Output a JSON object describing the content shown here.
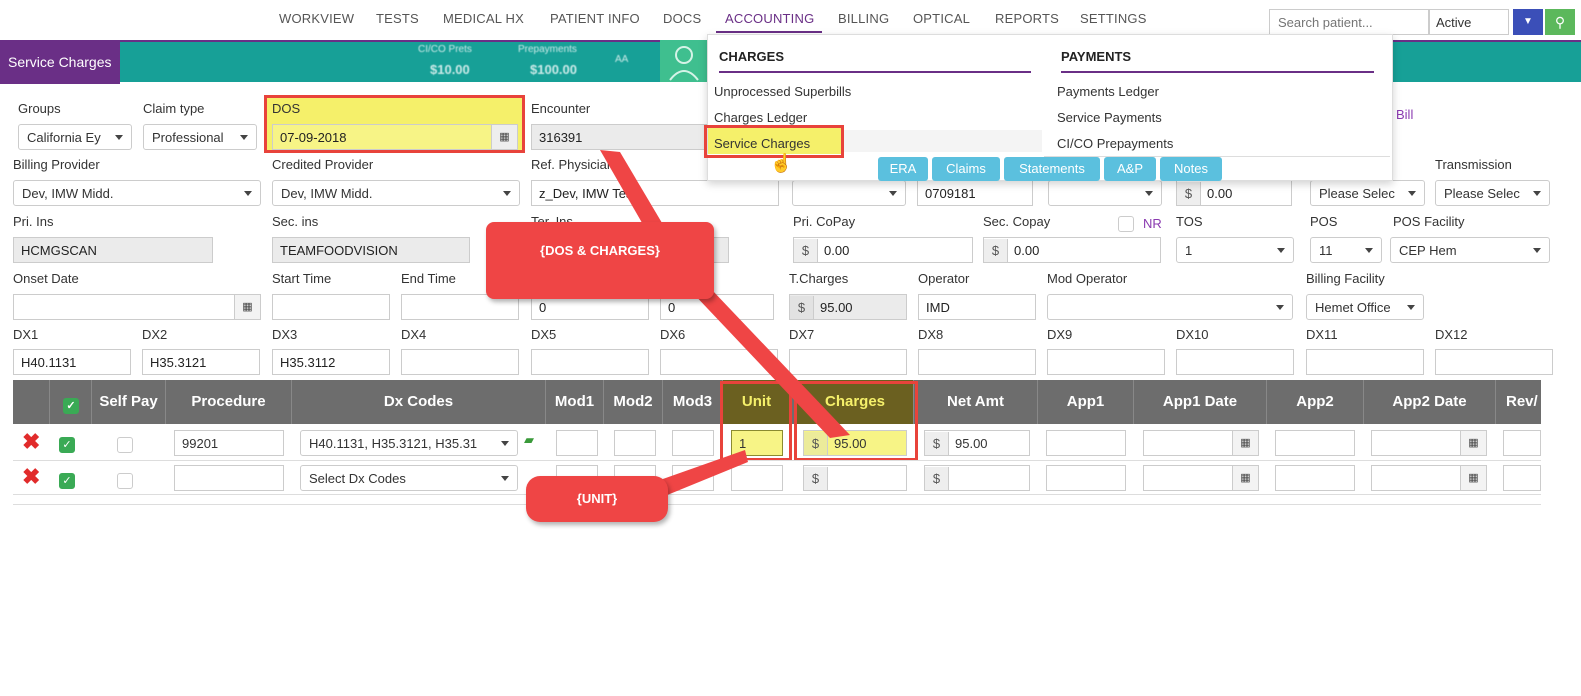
{
  "nav": {
    "items": [
      "WORKVIEW",
      "TESTS",
      "MEDICAL HX",
      "PATIENT INFO",
      "DOCS",
      "ACCOUNTING",
      "BILLING",
      "OPTICAL",
      "REPORTS",
      "SETTINGS"
    ],
    "active": "ACCOUNTING",
    "search_placeholder": "Search patient...",
    "status": "Active"
  },
  "page_tab": "Service Charges",
  "band": {
    "blur1": "CI/CO Prets",
    "blur2": "$10.00",
    "blur3": "Prepayments",
    "blur4": "$100.00",
    "blur5": "AA"
  },
  "form": {
    "groups_label": "Groups",
    "groups_value": "California Ey",
    "claim_label": "Claim type",
    "claim_value": "Professional",
    "dos_label": "DOS",
    "dos_value": "07-09-2018",
    "encounter_label": "Encounter",
    "encounter_value": "316391",
    "bill_link": "Bill",
    "billing_provider_label": "Billing Provider",
    "billing_provider_value": "Dev, IMW Midd.",
    "credited_label": "Credited Provider",
    "credited_value": "Dev, IMW Midd.",
    "ref_label": "Ref. Physician",
    "ref_value": "z_Dev, IMW Test",
    "hidden_value": "0709181",
    "amount_value": "0.00",
    "transmission_label": "Transmission",
    "please_select": "Please Selec",
    "pri_ins_label": "Pri. Ins",
    "pri_ins_value": "HCMGSCAN",
    "sec_ins_label": "Sec. ins",
    "sec_ins_value": "TEAMFOODVISION",
    "ter_label": "Ter. Ins",
    "pri_copay_label": "Pri. CoPay",
    "pri_copay_value": "0.00",
    "sec_copay_label": "Sec. Copay",
    "sec_copay_value": "0.00",
    "nr": "NR",
    "tos_label": "TOS",
    "tos_value": "1",
    "pos_label": "POS",
    "pos_value": "11",
    "pos_facility_label": "POS Facility",
    "pos_facility_value": "CEP Hem",
    "onset_label": "Onset Date",
    "start_label": "Start Time",
    "end_label": "End Time",
    "zero1": "0",
    "zero2": "0",
    "tcharges_label": "T.Charges",
    "tcharges_value": "95.00",
    "operator_label": "Operator",
    "operator_value": "IMD",
    "mod_operator_label": "Mod Operator",
    "billing_facility_label": "Billing Facility",
    "billing_facility_value": "Hemet Office",
    "dx_labels": [
      "DX1",
      "DX2",
      "DX3",
      "DX4",
      "DX5",
      "DX6",
      "DX7",
      "DX8",
      "DX9",
      "DX10",
      "DX11",
      "DX12"
    ],
    "dx_values": [
      "H40.1131",
      "H35.3121",
      "H35.3112",
      "",
      "",
      "",
      "",
      "",
      "",
      "",
      "",
      ""
    ]
  },
  "grid": {
    "headers": [
      "Self Pay",
      "Procedure",
      "Dx Codes",
      "Mod1",
      "Mod2",
      "Mod3",
      "Unit",
      "Charges",
      "Net Amt",
      "App1",
      "App1 Date",
      "App2",
      "App2 Date",
      "Rev/"
    ],
    "rows": [
      {
        "procedure": "99201",
        "dx": "H40.1131, H35.3121, H35.31",
        "unit": "1",
        "charges": "95.00",
        "net": "95.00"
      },
      {
        "procedure": "",
        "dx": "Select Dx Codes",
        "unit": "",
        "charges": "",
        "net": ""
      }
    ]
  },
  "menu": {
    "charges_head": "CHARGES",
    "payments_head": "PAYMENTS",
    "charges_items": [
      "Unprocessed Superbills",
      "Charges Ledger",
      "Service Charges"
    ],
    "payments_items": [
      "Payments Ledger",
      "Service Payments",
      "CI/CO Prepayments"
    ],
    "buttons": [
      "ERA",
      "Claims",
      "Statements",
      "A&P",
      "Notes"
    ]
  },
  "callouts": {
    "dos_charges": "{DOS & CHARGES}",
    "unit": "{UNIT}"
  },
  "colors": {
    "purple": "#6a2f86",
    "teal": "#17a097",
    "highlight": "#f5f06a",
    "annotation": "#ef4545"
  }
}
